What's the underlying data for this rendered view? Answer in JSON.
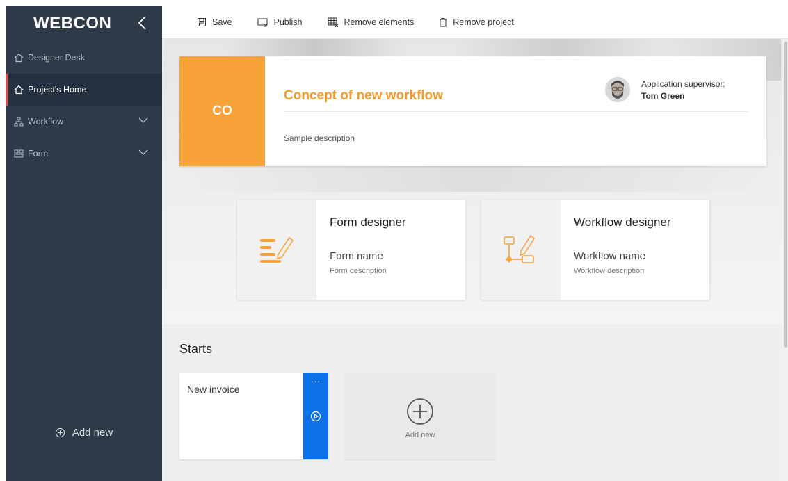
{
  "sidebar": {
    "logo": "WEBCON",
    "items": [
      {
        "label": "Designer Desk"
      },
      {
        "label": "Project's Home"
      },
      {
        "label": "Workflow"
      },
      {
        "label": "Form"
      }
    ],
    "add_new": "Add new"
  },
  "toolbar": {
    "save": "Save",
    "publish": "Publish",
    "remove_elements": "Remove elements",
    "remove_project": "Remove project"
  },
  "project": {
    "badge": "CO",
    "title": "Concept of new workflow",
    "description": "Sample description",
    "supervisor_label": "Application supervisor:",
    "supervisor_name": "Tom Green"
  },
  "tiles": {
    "form": {
      "title": "Form designer",
      "name": "Form name",
      "description": "Form description"
    },
    "workflow": {
      "title": "Workflow designer",
      "name": "Workflow name",
      "description": "Workflow description"
    }
  },
  "starts": {
    "title": "Starts",
    "items": [
      {
        "label": "New invoice",
        "more": "..."
      }
    ],
    "add_new": "Add new"
  },
  "colors": {
    "accent": "#f7a33a",
    "sidebar": "#2f3a48",
    "start_strip": "#0d70e6",
    "active_marker": "#e0483d"
  }
}
